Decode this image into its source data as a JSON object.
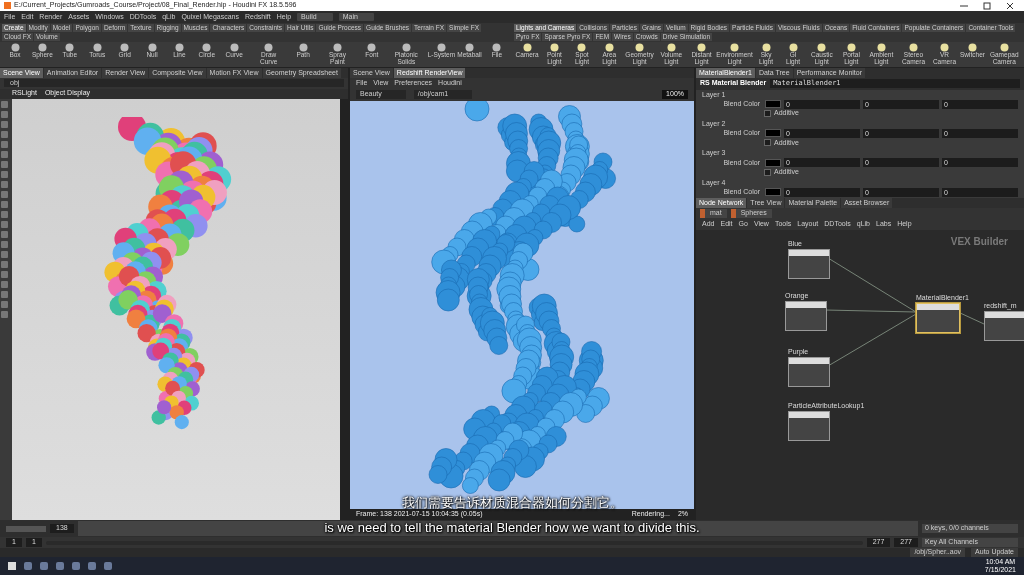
{
  "window": {
    "title": "E:/Current_Projects/Gumroads_Course/Project/08_Final_Render.hip - Houdini FX 18.5.596"
  },
  "menu": [
    "File",
    "Edit",
    "Render",
    "Assets",
    "Windows",
    "DDTools",
    "qLib",
    "Quixel Megascans",
    "Redshift",
    "Help"
  ],
  "desktop": {
    "build": "Build",
    "main": "Main"
  },
  "shelf_tabs_left": [
    {
      "label": "Create",
      "selected": true
    },
    {
      "label": "Modify",
      "selected": false
    },
    {
      "label": "Model",
      "selected": false
    },
    {
      "label": "Polygon",
      "selected": false
    },
    {
      "label": "Deform",
      "selected": false
    },
    {
      "label": "Texture",
      "selected": false
    },
    {
      "label": "Rigging",
      "selected": false
    },
    {
      "label": "Muscles",
      "selected": false
    },
    {
      "label": "Characters",
      "selected": false
    },
    {
      "label": "Constraints",
      "selected": false
    },
    {
      "label": "Hair Utils",
      "selected": false
    },
    {
      "label": "Guide Process",
      "selected": false
    },
    {
      "label": "Guide Brushes",
      "selected": false
    },
    {
      "label": "Terrain FX",
      "selected": false
    },
    {
      "label": "Simple FX",
      "selected": false
    },
    {
      "label": "Cloud FX",
      "selected": false
    },
    {
      "label": "Volume",
      "selected": false
    }
  ],
  "shelf_tabs_right": [
    {
      "label": "Lights and Cameras",
      "selected": true
    },
    {
      "label": "Collisions",
      "selected": false
    },
    {
      "label": "Particles",
      "selected": false
    },
    {
      "label": "Grains",
      "selected": false
    },
    {
      "label": "Vellum",
      "selected": false
    },
    {
      "label": "Rigid Bodies",
      "selected": false
    },
    {
      "label": "Particle Fluids",
      "selected": false
    },
    {
      "label": "Viscous Fluids",
      "selected": false
    },
    {
      "label": "Oceans",
      "selected": false
    },
    {
      "label": "Fluid Containers",
      "selected": false
    },
    {
      "label": "Populate Containers",
      "selected": false
    },
    {
      "label": "Container Tools",
      "selected": false
    },
    {
      "label": "Pyro FX",
      "selected": false
    },
    {
      "label": "Sparse Pyro FX",
      "selected": false
    },
    {
      "label": "FEM",
      "selected": false
    },
    {
      "label": "Wires",
      "selected": false
    },
    {
      "label": "Crowds",
      "selected": false
    },
    {
      "label": "Drive Simulation",
      "selected": false
    }
  ],
  "shelf_tools_left": [
    "Box",
    "Sphere",
    "Tube",
    "Torus",
    "Grid",
    "Null",
    "Line",
    "Circle",
    "Curve",
    "Draw Curve",
    "Path",
    "Spray Paint",
    "Font",
    "Platonic Solids",
    "L-System",
    "Metaball",
    "File"
  ],
  "shelf_tools_right": [
    "Camera",
    "Point Light",
    "Spot Light",
    "Area Light",
    "Geometry Light",
    "Volume Light",
    "Distant Light",
    "Environment Light",
    "Sky Light",
    "GI Light",
    "Caustic Light",
    "Portal Light",
    "Ambient Light",
    "Stereo Camera",
    "VR Camera",
    "Switcher",
    "Gamepad Camera"
  ],
  "left_pane": {
    "tabs": [
      {
        "label": "Scene View",
        "selected": true
      },
      {
        "label": "Animation Editor",
        "selected": false
      },
      {
        "label": "Render View",
        "selected": false
      },
      {
        "label": "Composite View",
        "selected": false
      },
      {
        "label": "Motion FX View",
        "selected": false
      },
      {
        "label": "Geometry Spreadsheet",
        "selected": false
      }
    ],
    "path": "obj",
    "camera": "RSLight",
    "display": "Object Display"
  },
  "middle_pane": {
    "tabs": [
      {
        "label": "Scene View",
        "selected": false
      },
      {
        "label": "Redshift RenderView",
        "selected": true
      }
    ],
    "menu": [
      "File",
      "View",
      "Preferences",
      "Houdini"
    ],
    "aov": "Beauty",
    "camera": "/obj/cam1",
    "zoom": "100%",
    "footer": "Frame: 138   2021-07-15  10:04:35  (0.05s)",
    "status": "Rendering...",
    "progress": "2%"
  },
  "right_pane": {
    "tabs": [
      {
        "label": "MaterialBlender1",
        "selected": true
      },
      {
        "label": "Data Tree",
        "selected": false
      },
      {
        "label": "Performance Monitor",
        "selected": false
      }
    ],
    "node_type": "RS Material Blender",
    "node_name": "MaterialBlender1",
    "layers": [
      {
        "title": "Layer 1",
        "label": "Blend Color",
        "values": [
          "0",
          "0",
          "0"
        ],
        "additive_label": "Additive",
        "additive": false
      },
      {
        "title": "Layer 2",
        "label": "Blend Color",
        "values": [
          "0",
          "0",
          "0"
        ],
        "additive_label": "Additive",
        "additive": false
      },
      {
        "title": "Layer 3",
        "label": "Blend Color",
        "values": [
          "0",
          "0",
          "0"
        ],
        "additive_label": "Additive",
        "additive": false
      },
      {
        "title": "Layer 4",
        "label": "Blend Color",
        "values": [
          "0",
          "0",
          "0"
        ]
      }
    ]
  },
  "network": {
    "tabs": [
      {
        "label": "Node Network",
        "selected": true
      },
      {
        "label": "Tree View",
        "selected": false
      },
      {
        "label": "Material Palette",
        "selected": false
      },
      {
        "label": "Asset Browser",
        "selected": false
      }
    ],
    "path": [
      "mat",
      "Spheres"
    ],
    "menu": [
      "Add",
      "Edit",
      "Go",
      "View",
      "Tools",
      "Layout",
      "DDTools",
      "qLib",
      "Labs",
      "Help"
    ],
    "context": "VEX Builder",
    "nodes": [
      {
        "name": "Blue",
        "selected": false
      },
      {
        "name": "Orange",
        "selected": false
      },
      {
        "name": "Purple",
        "selected": false
      },
      {
        "name": "ParticleAttributeLookup1",
        "selected": false
      },
      {
        "name": "MaterialBlender1",
        "selected": true
      },
      {
        "name": "redshift_m",
        "selected": false
      }
    ]
  },
  "timeline": {
    "frame": "138",
    "start": "1",
    "start2": "1",
    "end": "277",
    "end2": "277",
    "keys": "0 keys, 0/0 channels",
    "key_all": "Key All Channels",
    "path": "/obj/Spher..aov",
    "update": "Auto Update"
  },
  "subtitles": {
    "chinese": "我们需要告诉材质混合器如何分割它。",
    "english": "is we need to tell the material Blender how we want to divide this."
  },
  "taskbar": {
    "time": "10:04 AM",
    "date": "7/15/2021"
  }
}
